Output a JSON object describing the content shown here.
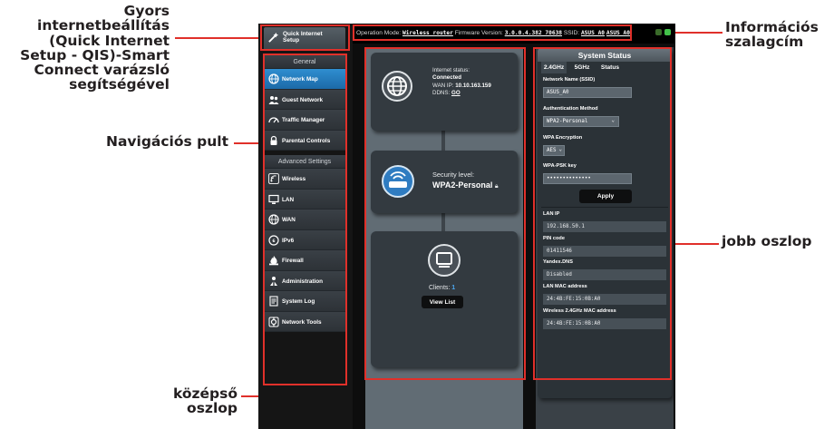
{
  "annotations": {
    "qis": [
      "Gyors",
      "internetbeállítás",
      "(Quick Internet",
      "Setup - QIS)-Smart",
      "Connect varázsló",
      "segítségével"
    ],
    "nav": "Navigációs pult",
    "center": [
      "középső",
      "oszlop"
    ],
    "info": [
      "Információs",
      "szalagcím"
    ],
    "right": "jobb oszlop"
  },
  "topbar": {
    "mode_label": "Operation Mode:",
    "mode_value": "Wireless router",
    "fw_label": "Firmware Version:",
    "fw_value": "3.0.0.4.382_70638",
    "ssid_label": "SSID:",
    "ssid_1": "ASUS_A0",
    "ssid_2": "ASUS_A0"
  },
  "sidebar": {
    "qis_line1": "Quick Internet",
    "qis_line2": "Setup",
    "general_header": "General",
    "general_items": [
      {
        "label": "Network Map",
        "icon": "globe-icon",
        "active": true
      },
      {
        "label": "Guest Network",
        "icon": "users-icon"
      },
      {
        "label": "Traffic Manager",
        "icon": "gauge-icon"
      },
      {
        "label": "Parental Controls",
        "icon": "lock-icon"
      }
    ],
    "advanced_header": "Advanced Settings",
    "advanced_items": [
      {
        "label": "Wireless",
        "icon": "wifi-icon"
      },
      {
        "label": "LAN",
        "icon": "monitor-icon"
      },
      {
        "label": "WAN",
        "icon": "globe-icon"
      },
      {
        "label": "IPv6",
        "icon": "ipv6-icon"
      },
      {
        "label": "Firewall",
        "icon": "fire-icon"
      },
      {
        "label": "Administration",
        "icon": "admin-icon"
      },
      {
        "label": "System Log",
        "icon": "log-icon"
      },
      {
        "label": "Network Tools",
        "icon": "tools-icon"
      }
    ]
  },
  "center": {
    "internet_status_label": "Internet status:",
    "internet_status_value": "Connected",
    "wan_ip_label": "WAN IP:",
    "wan_ip_value": "10.10.163.159",
    "ddns_label": "DDNS:",
    "ddns_value": "GO",
    "security_label": "Security level:",
    "security_value": "WPA2-Personal",
    "clients_label": "Clients:",
    "clients_value": "1",
    "view_list": "View List"
  },
  "status": {
    "title": "System Status",
    "tabs": [
      "2.4GHz",
      "5GHz",
      "Status"
    ],
    "ssid_label": "Network Name (SSID)",
    "ssid_value": "ASUS_A0",
    "auth_label": "Authentication Method",
    "auth_value": "WPA2-Personal",
    "enc_label": "WPA Encryption",
    "enc_value": "AES",
    "psk_label": "WPA-PSK key",
    "psk_value": "••••••••••••••",
    "apply": "Apply",
    "lan_ip_label": "LAN IP",
    "lan_ip_value": "192.168.50.1",
    "pin_label": "PIN code",
    "pin_value": "01411546",
    "dns_label": "Yandex.DNS",
    "dns_value": "Disabled",
    "lan_mac_label": "LAN MAC address",
    "lan_mac_value": "24:4B:FE:15:0B:A0",
    "wmac_label": "Wireless 2.4GHz MAC address",
    "wmac_value": "24:4B:FE:15:0B:A0"
  },
  "colors": {
    "annotation_red": "#e0302a",
    "active_blue": "#1c6aa8"
  }
}
